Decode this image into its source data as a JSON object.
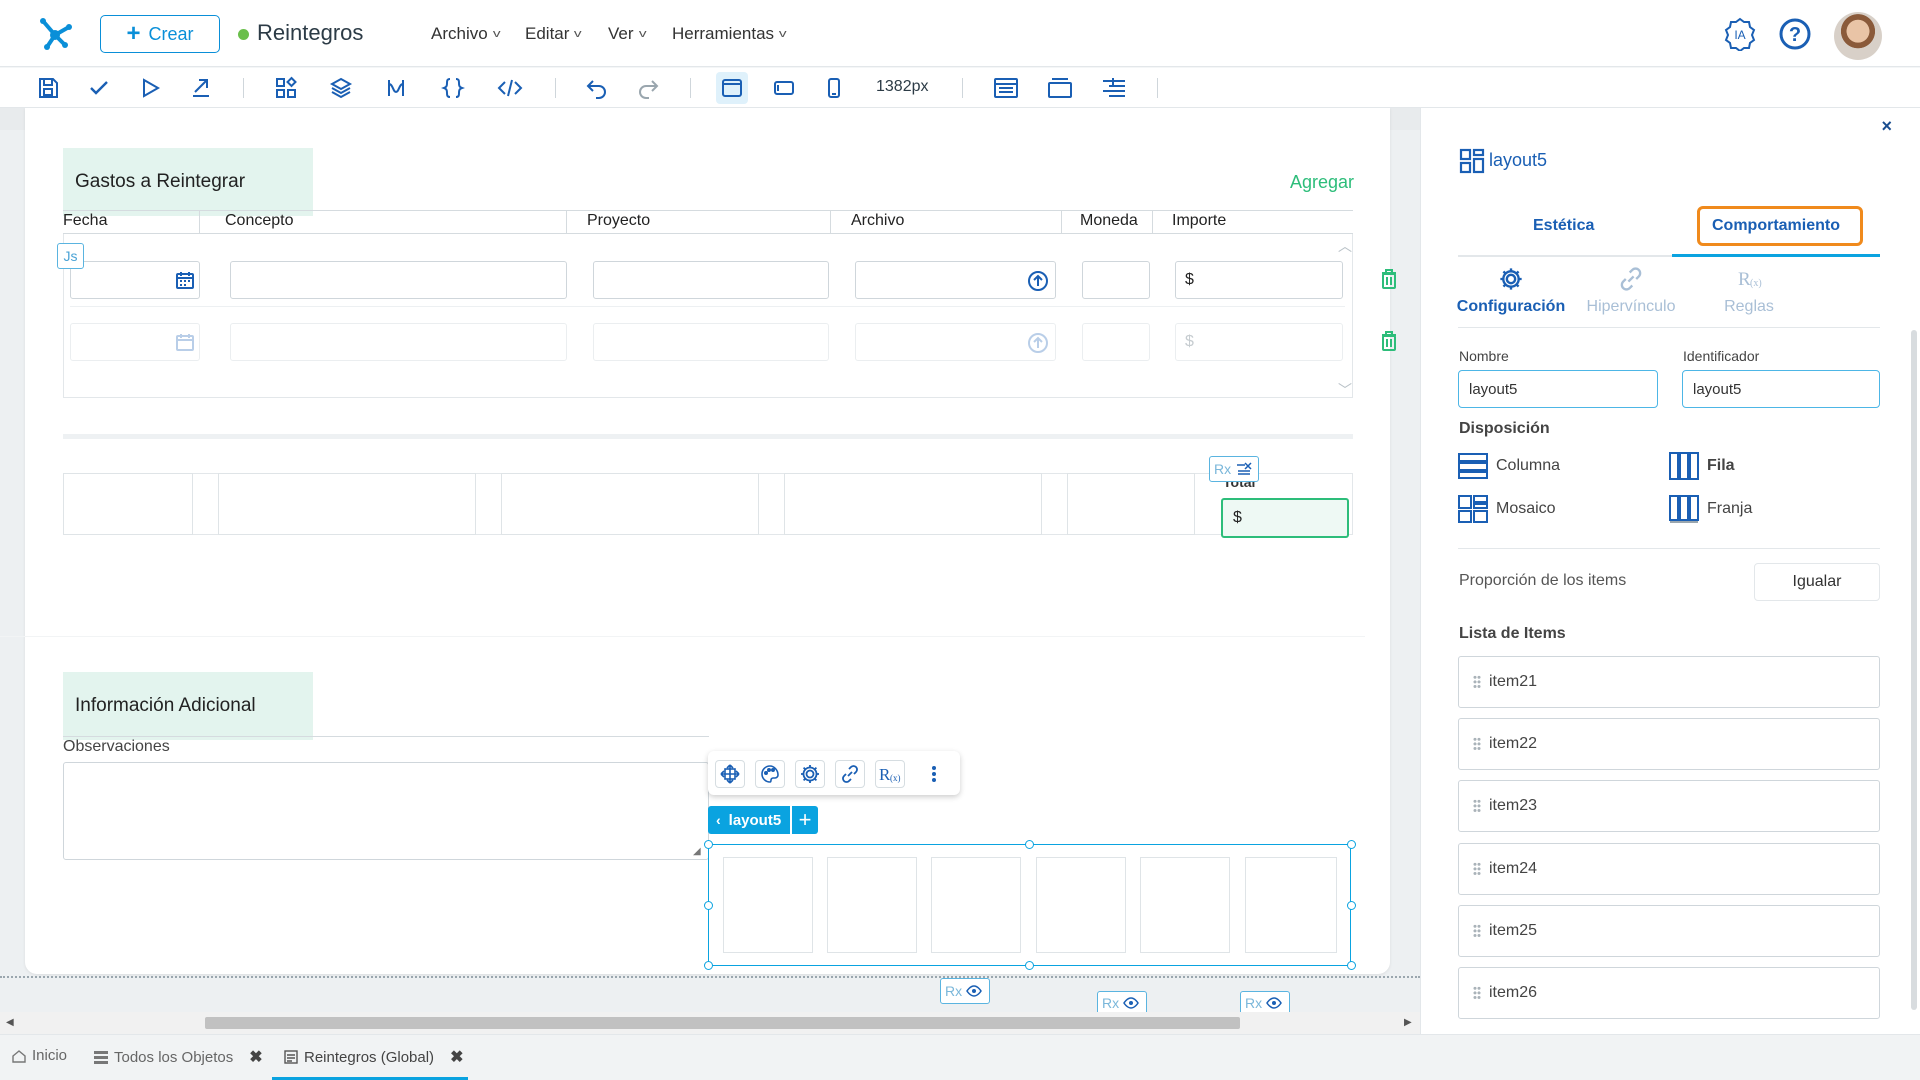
{
  "header": {
    "create_label": "Crear",
    "app_title": "Reintegros",
    "menus": [
      "Archivo",
      "Editar",
      "Ver",
      "Herramientas"
    ],
    "ai_label": "IA",
    "help_label": "?"
  },
  "toolbar": {
    "width_label": "1382px"
  },
  "form": {
    "section1_title": "Gastos a Reintegrar",
    "add_label": "Agregar",
    "columns": [
      "Fecha",
      "Concepto",
      "Proyecto",
      "Archivo",
      "Moneda",
      "Importe"
    ],
    "currency_symbol": "$",
    "js_badge": "Js",
    "rx_label": "Rx",
    "total_label": "Total",
    "section2_title": "Información Adicional",
    "observaciones_label": "Observaciones"
  },
  "selection": {
    "tag_label": "layout5"
  },
  "panel": {
    "title": "layout5",
    "tabs": [
      "Estética",
      "Comportamiento"
    ],
    "subtabs": [
      "Configuración",
      "Hipervínculo",
      "Reglas"
    ],
    "nombre_label": "Nombre",
    "nombre_value": "layout5",
    "identificador_label": "Identificador",
    "identificador_value": "layout5",
    "disposicion_label": "Disposición",
    "disposiciones": [
      "Columna",
      "Fila",
      "Mosaico",
      "Franja"
    ],
    "proporcion_label": "Proporción de los items",
    "igualar_label": "Igualar",
    "lista_label": "Lista de Items",
    "items": [
      "item21",
      "item22",
      "item23",
      "item24",
      "item25",
      "item26"
    ]
  },
  "bottom_tabs": [
    "Inicio",
    "Todos los Objetos",
    "Reintegros (Global)"
  ],
  "colors": {
    "accent": "#0aa3e0",
    "brand_blue": "#1a5fb4",
    "highlight_orange": "#f08a1c",
    "green": "#2dbd7a"
  }
}
